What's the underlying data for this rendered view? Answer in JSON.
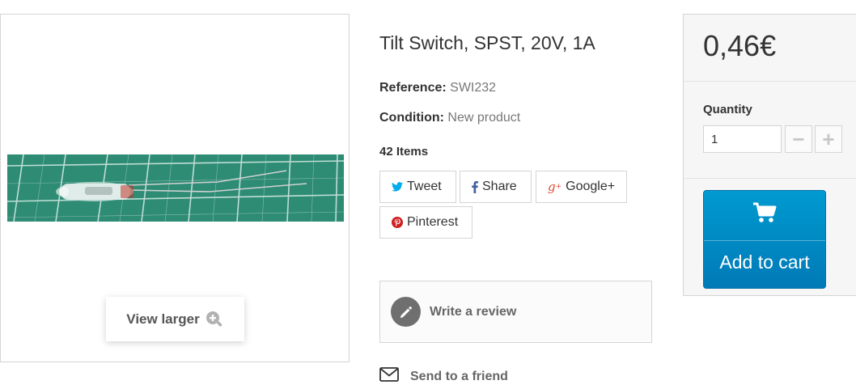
{
  "product": {
    "title": "Tilt Switch, SPST, 20V, 1A",
    "reference_label": "Reference:",
    "reference_value": "SWI232",
    "condition_label": "Condition:",
    "condition_value": "New product",
    "stock": "42 Items",
    "view_larger": "View larger"
  },
  "social": {
    "tweet": "Tweet",
    "share": "Share",
    "google": "Google+",
    "pinterest": "Pinterest"
  },
  "actions": {
    "write_review": "Write a review",
    "send_friend": "Send to a friend"
  },
  "buy": {
    "price": "0,46€",
    "quantity_label": "Quantity",
    "quantity_value": "1",
    "minus": "−",
    "plus": "+",
    "add_to_cart": "Add to cart"
  },
  "icons": {
    "tweet": "twitter-icon",
    "share": "facebook-icon",
    "google": "google-plus-icon",
    "pinterest": "pinterest-icon",
    "review": "pencil-icon",
    "send": "envelope-icon",
    "cart": "cart-icon",
    "zoom": "zoom-plus-icon"
  },
  "colors": {
    "cart_button": "#0085c3",
    "twitter": "#00aced",
    "facebook": "#435f9f",
    "google": "#e04b34",
    "pinterest": "#ce1f21"
  }
}
